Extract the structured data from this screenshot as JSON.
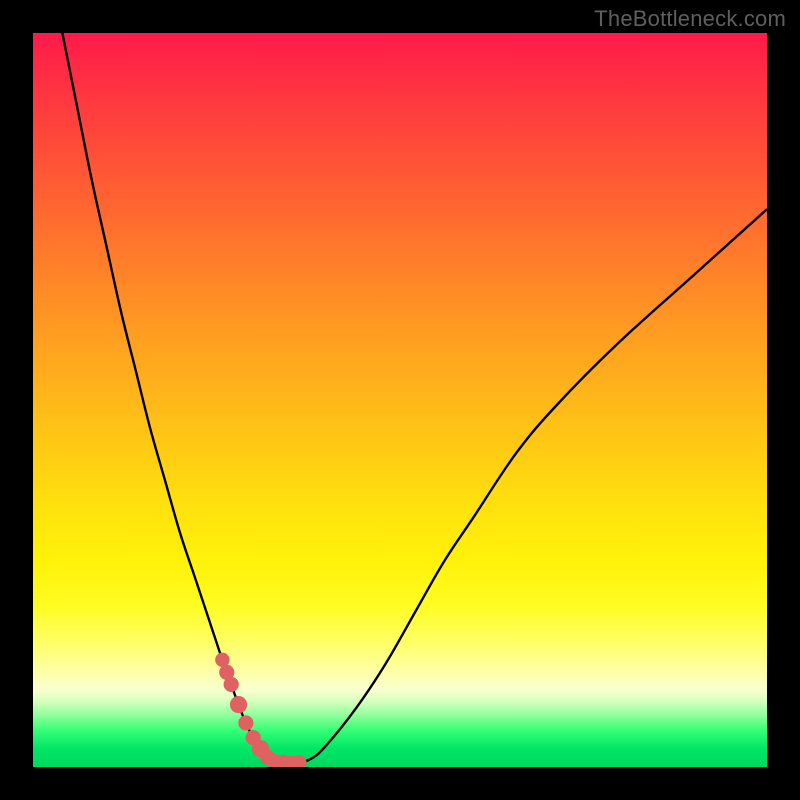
{
  "watermark": "TheBottleneck.com",
  "chart_data": {
    "type": "line",
    "title": "",
    "xlabel": "",
    "ylabel": "",
    "xlim": [
      0,
      100
    ],
    "ylim": [
      0,
      100
    ],
    "series": [
      {
        "name": "bottleneck-curve",
        "x": [
          4,
          6,
          8,
          10,
          12,
          14,
          16,
          18,
          20,
          22,
          24,
          26,
          28,
          29,
          30,
          31,
          32,
          33,
          34,
          36,
          38,
          40,
          44,
          48,
          52,
          56,
          60,
          66,
          72,
          80,
          90,
          100
        ],
        "values": [
          100,
          90,
          80,
          71,
          62,
          54,
          46,
          39,
          32,
          26,
          20,
          14,
          8.5,
          6,
          4,
          2.5,
          1.3,
          0.7,
          0.5,
          0.5,
          1.2,
          3,
          8,
          14,
          21,
          28,
          34,
          43,
          50,
          58,
          67,
          76
        ]
      }
    ],
    "threshold_markers": {
      "on_curve_percent_y": 6,
      "points_x": [
        25.8,
        26.4,
        27.0,
        28.0,
        29.0,
        30.0,
        31.0,
        32.0,
        33.0,
        34.0,
        35.0,
        35.8,
        36.3
      ]
    },
    "colors": {
      "curve": "#000000",
      "markers": "#e06161",
      "gradient_top": "#ff1a49",
      "gradient_mid": "#ffd200",
      "gradient_bottom": "#00d85e"
    }
  }
}
